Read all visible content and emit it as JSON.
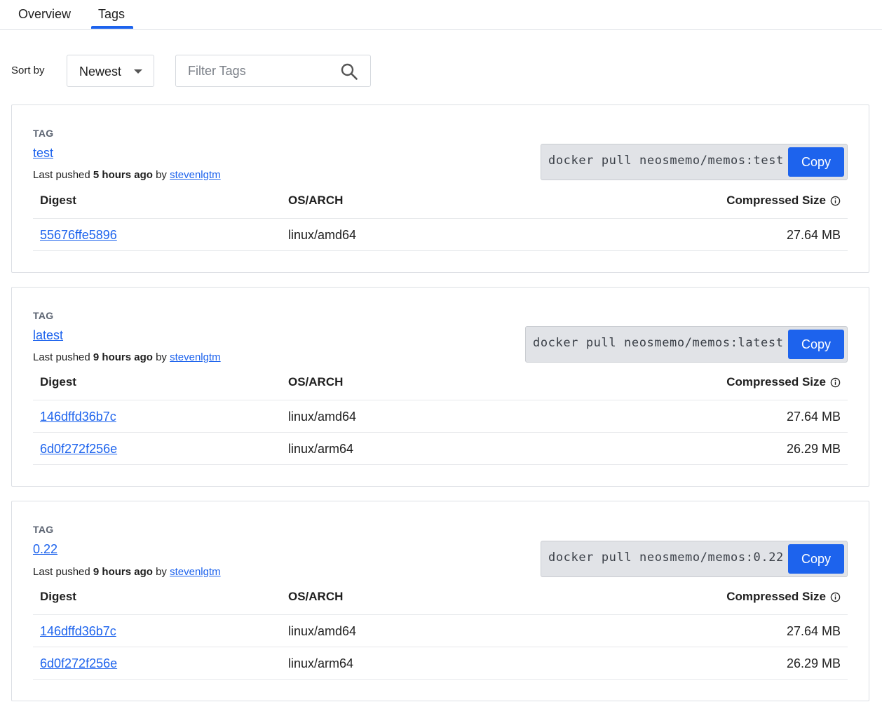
{
  "tabs": [
    {
      "label": "Overview",
      "active": false
    },
    {
      "label": "Tags",
      "active": true
    }
  ],
  "toolbar": {
    "sort_label": "Sort by",
    "sort_value": "Newest",
    "filter_placeholder": "Filter Tags",
    "filter_value": ""
  },
  "table_headers": {
    "digest": "Digest",
    "os_arch": "OS/ARCH",
    "size": "Compressed Size"
  },
  "accent_color": "#1d63ed",
  "tags": [
    {
      "label": "TAG",
      "name": "test",
      "pushed_prefix": "Last pushed",
      "pushed_time": "5 hours ago",
      "pushed_by_word": "by",
      "pushed_by": "stevenlgtm",
      "pull_command": "docker pull neosmemo/memos:test",
      "copy_label": "Copy",
      "rows": [
        {
          "digest": "55676ffe5896",
          "os_arch": "linux/amd64",
          "size": "27.64 MB"
        }
      ]
    },
    {
      "label": "TAG",
      "name": "latest",
      "pushed_prefix": "Last pushed",
      "pushed_time": "9 hours ago",
      "pushed_by_word": "by",
      "pushed_by": "stevenlgtm",
      "pull_command": "docker pull neosmemo/memos:latest",
      "copy_label": "Copy",
      "rows": [
        {
          "digest": "146dffd36b7c",
          "os_arch": "linux/amd64",
          "size": "27.64 MB"
        },
        {
          "digest": "6d0f272f256e",
          "os_arch": "linux/arm64",
          "size": "26.29 MB"
        }
      ]
    },
    {
      "label": "TAG",
      "name": "0.22",
      "pushed_prefix": "Last pushed",
      "pushed_time": "9 hours ago",
      "pushed_by_word": "by",
      "pushed_by": "stevenlgtm",
      "pull_command": "docker pull neosmemo/memos:0.22",
      "copy_label": "Copy",
      "rows": [
        {
          "digest": "146dffd36b7c",
          "os_arch": "linux/amd64",
          "size": "27.64 MB"
        },
        {
          "digest": "6d0f272f256e",
          "os_arch": "linux/arm64",
          "size": "26.29 MB"
        }
      ]
    }
  ]
}
